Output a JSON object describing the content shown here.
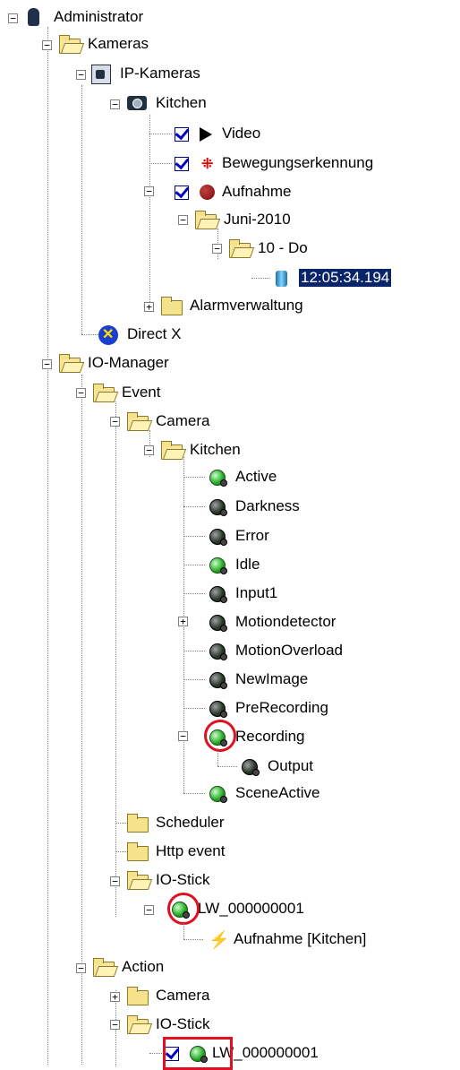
{
  "tree": {
    "administrator": "Administrator",
    "kameras": "Kameras",
    "ip_kameras": "IP-Kameras",
    "kitchen_camera": "Kitchen",
    "video": "Video",
    "bewegung": "Bewegungserkennung",
    "aufnahme": "Aufnahme",
    "juni": "Juni-2010",
    "day": "10 - Do",
    "recording_time": "12:05:34.194",
    "alarmverwaltung": "Alarmverwaltung",
    "directx": "Direct X",
    "io_manager": "IO-Manager",
    "event": "Event",
    "camera": "Camera",
    "kitchen_event": "Kitchen",
    "events": [
      "Active",
      "Darkness",
      "Error",
      "Idle",
      "Input1",
      "Motiondetector",
      "MotionOverload",
      "NewImage",
      "PreRecording",
      "Recording"
    ],
    "output": "Output",
    "scene_active": "SceneActive",
    "scheduler": "Scheduler",
    "http_event": "Http event",
    "io_stick": "IO-Stick",
    "lw1": "LW_000000001",
    "aufnahme_kitchen": "Aufnahme [Kitchen]",
    "action": "Action",
    "action_camera": "Camera",
    "action_io_stick": "IO-Stick",
    "lw2": "LW_000000001"
  },
  "colors": {
    "highlight": "#e01020",
    "selection": "#0a246a"
  }
}
